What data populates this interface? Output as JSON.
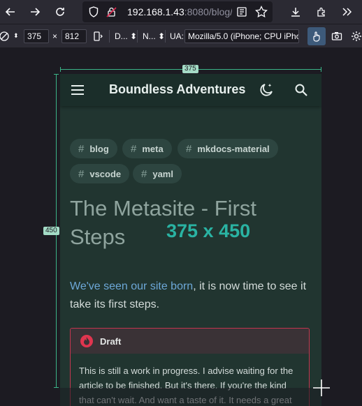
{
  "browser": {
    "url_host": "192.168.1.43",
    "url_rest": ":8080/blog/",
    "icons": [
      "back-icon",
      "forward-icon",
      "reload-icon",
      "shield-icon",
      "lock-icon",
      "reader-icon",
      "bookmark-star-icon",
      "download-icon",
      "extensions-icon",
      "overflow-icon"
    ]
  },
  "responsive_toolbar": {
    "width_value": "375",
    "times": "×",
    "height_value": "812",
    "dpr_label": "D...",
    "network_label": "N...",
    "ua_label": "UA:",
    "ua_value": "Mozilla/5.0 (iPhone; CPU iPho",
    "icons": [
      "touch-icon",
      "screenshot-icon",
      "settings-icon",
      "rotate-icon"
    ]
  },
  "rulers": {
    "width_tag": "375",
    "height_tag": "450"
  },
  "site": {
    "title": "Boundless Adventures",
    "tags": [
      "blog",
      "meta",
      "mkdocs-material",
      "vscode",
      "yaml"
    ],
    "heading": "The Metasite - First Steps",
    "viewport_overlay": "375 x 450",
    "intro_link": "We've seen our site born",
    "intro_rest": ", it is now time to see it take its first steps.",
    "admonition_title": "Draft",
    "admonition_text": "This is still a work in progress. I advise waiting for the article to be finished. But it's there. If you're the kind that can't wait. And want a taste of it. It needs a great"
  },
  "colors": {
    "accent": "#2ab3a3",
    "link": "#6da8d8",
    "draft": "#e0354f"
  }
}
